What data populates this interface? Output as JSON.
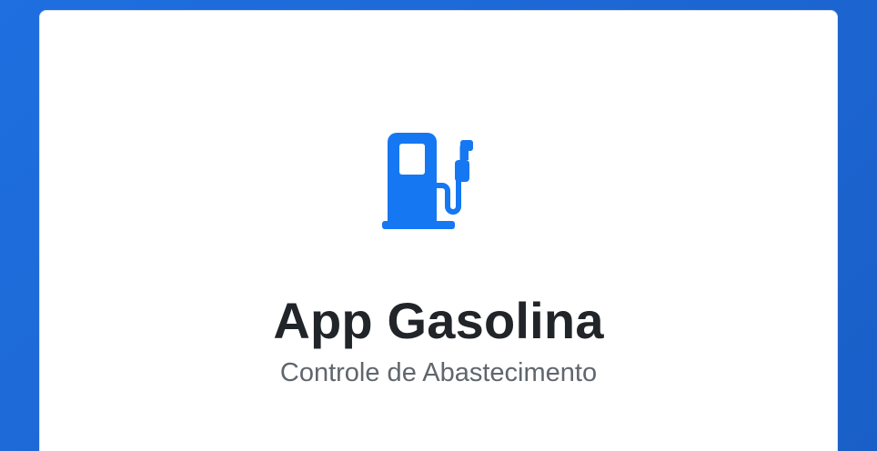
{
  "app": {
    "title": "App Gasolina",
    "subtitle": "Controle de Abastecimento",
    "icon": "fuel-pump-icon"
  },
  "colors": {
    "background": "#1f6fe0",
    "card": "#ffffff",
    "accent": "#1677f2",
    "title": "#212529",
    "subtitle": "#5f666d"
  }
}
